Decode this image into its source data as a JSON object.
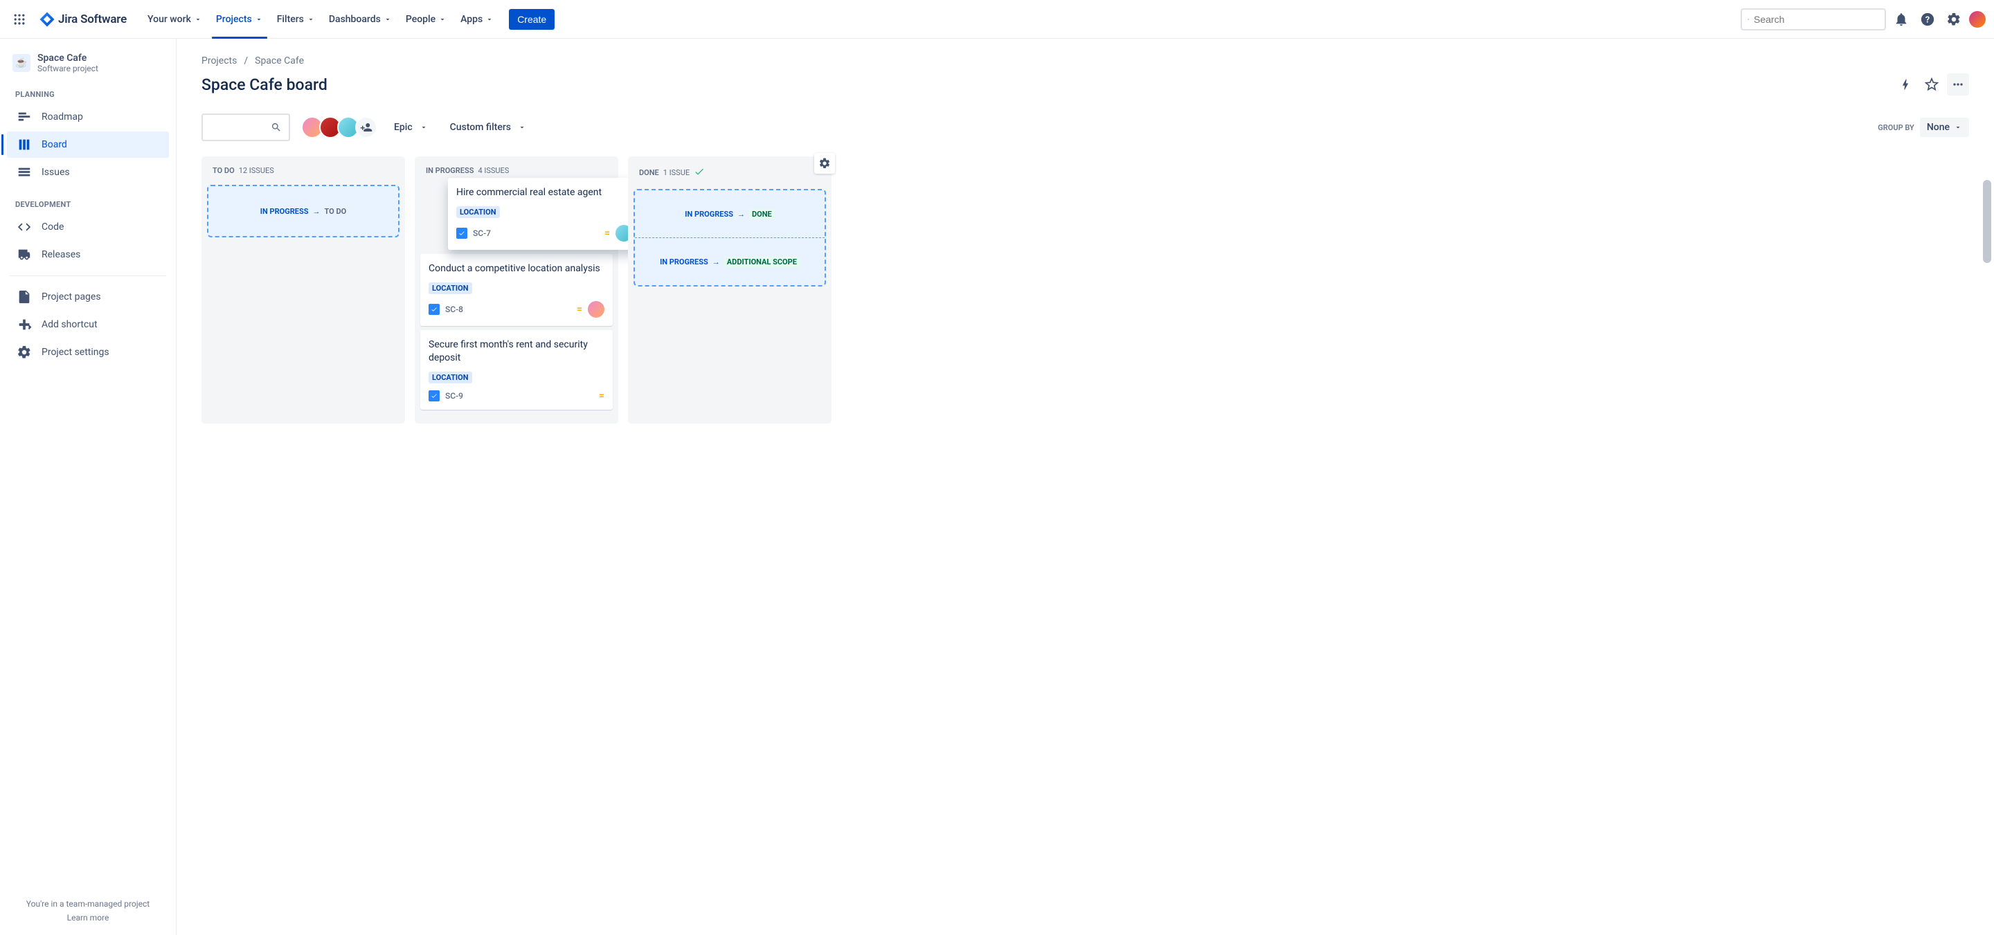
{
  "nav": {
    "logo": "Jira Software",
    "items": [
      "Your work",
      "Projects",
      "Filters",
      "Dashboards",
      "People",
      "Apps"
    ],
    "active_index": 1,
    "create": "Create",
    "search_placeholder": "Search"
  },
  "sidebar": {
    "project_name": "Space Cafe",
    "project_sub": "Software project",
    "sections": {
      "planning": {
        "label": "PLANNING",
        "items": [
          "Roadmap",
          "Board",
          "Issues"
        ],
        "active_index": 1
      },
      "development": {
        "label": "DEVELOPMENT",
        "items": [
          "Code",
          "Releases"
        ]
      }
    },
    "other": [
      "Project pages",
      "Add shortcut",
      "Project settings"
    ],
    "footer_line": "You're in a team-managed project",
    "footer_link": "Learn more"
  },
  "breadcrumbs": [
    "Projects",
    "Space Cafe"
  ],
  "page_title": "Space Cafe board",
  "toolbar": {
    "epic": "Epic",
    "custom_filters": "Custom filters",
    "group_by_label": "GROUP BY",
    "group_by_value": "None"
  },
  "columns": [
    {
      "name": "TO DO",
      "count": "12 ISSUES",
      "drop_zones": [
        {
          "from": "IN PROGRESS",
          "to": "TO DO",
          "to_style": "keep"
        }
      ],
      "cards": []
    },
    {
      "name": "IN PROGRESS",
      "count": "4 ISSUES",
      "drop_zones": [],
      "cards": [
        {
          "title": "Hire commercial real estate agent",
          "epic": "LOCATION",
          "key": "SC-7",
          "dragging": true,
          "avatar": "av3"
        },
        {
          "title": "Conduct a competitive location analysis",
          "epic": "LOCATION",
          "key": "SC-8",
          "avatar": "av1"
        },
        {
          "title": "Secure first month's rent and security deposit",
          "epic": "LOCATION",
          "key": "SC-9",
          "avatar": ""
        }
      ]
    },
    {
      "name": "DONE",
      "count": "1 ISSUE",
      "has_check": true,
      "has_config": true,
      "drop_zones": [
        {
          "from": "IN PROGRESS",
          "to": "DONE",
          "to_style": "done"
        },
        {
          "from": "IN PROGRESS",
          "to": "ADDITIONAL SCOPE",
          "to_style": "scope"
        }
      ],
      "cards": []
    }
  ]
}
